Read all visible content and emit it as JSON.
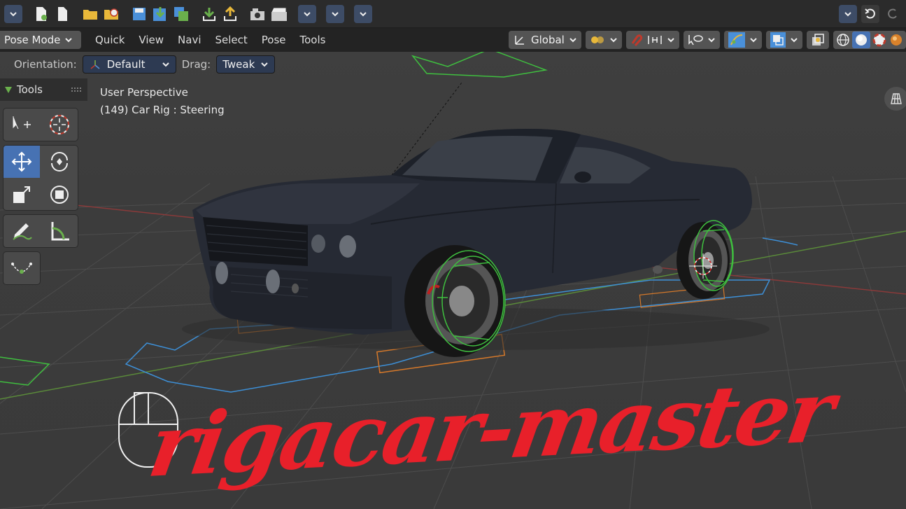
{
  "header": {
    "mode": "Pose Mode",
    "menus": [
      "Quick",
      "View",
      "Navi",
      "Select",
      "Pose",
      "Tools"
    ],
    "transform_orientation": "Global"
  },
  "tool_settings": {
    "orientation_label": "Orientation:",
    "orientation_value": "Default",
    "drag_label": "Drag:",
    "drag_value": "Tweak"
  },
  "tools_panel": {
    "title": "Tools"
  },
  "viewport": {
    "view_name": "User Perspective",
    "object_info": "(149) Car Rig : Steering"
  },
  "watermark": {
    "text": "rigacar-master"
  },
  "colors": {
    "accent": "#4772b3",
    "watermark": "#e8202a",
    "rig_green": "#3fbf3f",
    "rig_blue": "#3d8fd6",
    "rig_orange": "#d4782a"
  }
}
